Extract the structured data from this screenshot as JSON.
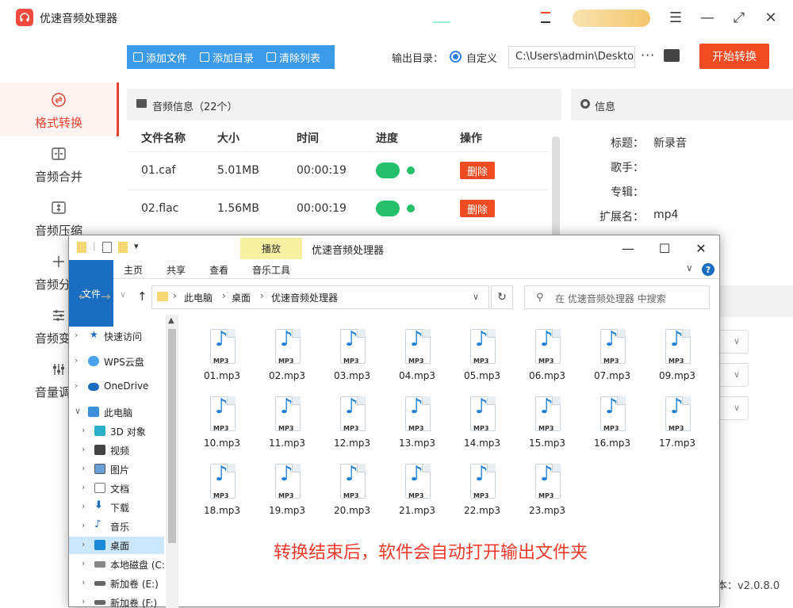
{
  "app": {
    "title": "优速音频处理器",
    "window_controls": [
      "menu",
      "minimize",
      "maximize",
      "close"
    ]
  },
  "sidebar": {
    "items": [
      {
        "label": "格式转换",
        "icon": "swap-circle-icon",
        "active": true
      },
      {
        "label": "音频合并",
        "icon": "merge-icon"
      },
      {
        "label": "音频压缩",
        "icon": "compress-icon"
      },
      {
        "label": "音频分",
        "icon": "split-icon"
      },
      {
        "label": "音频变",
        "icon": "equalizer-icon"
      },
      {
        "label": "音量调",
        "icon": "volume-sliders-icon"
      }
    ]
  },
  "toolbar": {
    "add_file": "添加文件",
    "add_folder": "添加目录",
    "clear_list": "清除列表",
    "output_label": "输出目录：",
    "custom_label": "自定义",
    "output_path": "C:\\Users\\admin\\Deskto",
    "more": "···",
    "start": "开始转换"
  },
  "file_list": {
    "header": "音频信息（22个）",
    "columns": [
      "文件名称",
      "大小",
      "时间",
      "进度",
      "操作"
    ],
    "rows": [
      {
        "name": "01.caf",
        "size": "5.01MB",
        "time": "00:00:19",
        "action": "删除"
      },
      {
        "name": "02.flac",
        "size": "1.56MB",
        "time": "00:00:19",
        "action": "删除"
      }
    ]
  },
  "info": {
    "header": "信息",
    "fields": [
      {
        "label": "标题：",
        "value": "新录音"
      },
      {
        "label": "歌手：",
        "value": ""
      },
      {
        "label": "专辑：",
        "value": ""
      },
      {
        "label": "扩展名：",
        "value": "mp4"
      }
    ],
    "version_label": "本：",
    "version": "v2.0.8.0"
  },
  "explorer": {
    "context_tab": "播放",
    "title": "优速音频处理器",
    "ribbon_tabs": [
      "文件",
      "主页",
      "共享",
      "查看",
      "音乐工具"
    ],
    "breadcrumb": [
      "此电脑",
      "桌面",
      "优速音频处理器"
    ],
    "search_placeholder": "在 优速音频处理器 中搜索",
    "nav": [
      {
        "label": "快速访问",
        "icon": "star-icon"
      },
      {
        "label": "WPS云盘",
        "icon": "cloud-icon"
      },
      {
        "label": "OneDrive",
        "icon": "onedrive-icon"
      },
      {
        "label": "此电脑",
        "icon": "computer-icon"
      },
      {
        "label": "3D 对象",
        "icon": "cube-icon"
      },
      {
        "label": "视频",
        "icon": "video-icon"
      },
      {
        "label": "图片",
        "icon": "picture-icon"
      },
      {
        "label": "文档",
        "icon": "document-icon"
      },
      {
        "label": "下载",
        "icon": "download-icon"
      },
      {
        "label": "音乐",
        "icon": "music-icon"
      },
      {
        "label": "桌面",
        "icon": "desktop-icon",
        "selected": true
      },
      {
        "label": "本地磁盘 (C:",
        "icon": "disk-icon"
      },
      {
        "label": "新加卷 (E:)",
        "icon": "disk-icon"
      },
      {
        "label": "新加卷 (F:)",
        "icon": "disk-icon"
      }
    ],
    "files": [
      "01.mp3",
      "02.mp3",
      "03.mp3",
      "04.mp3",
      "05.mp3",
      "06.mp3",
      "07.mp3",
      "09.mp3",
      "10.mp3",
      "11.mp3",
      "12.mp3",
      "13.mp3",
      "14.mp3",
      "15.mp3",
      "16.mp3",
      "17.mp3",
      "18.mp3",
      "19.mp3",
      "20.mp3",
      "21.mp3",
      "22.mp3",
      "23.mp3"
    ],
    "file_tag": "MP3",
    "caption": "转换结束后，软件会自动打开输出文件夹"
  },
  "colors": {
    "accent": "#f04b22",
    "blue": "#3c9be8",
    "success": "#27c06a",
    "caption": "#f03a2c"
  }
}
